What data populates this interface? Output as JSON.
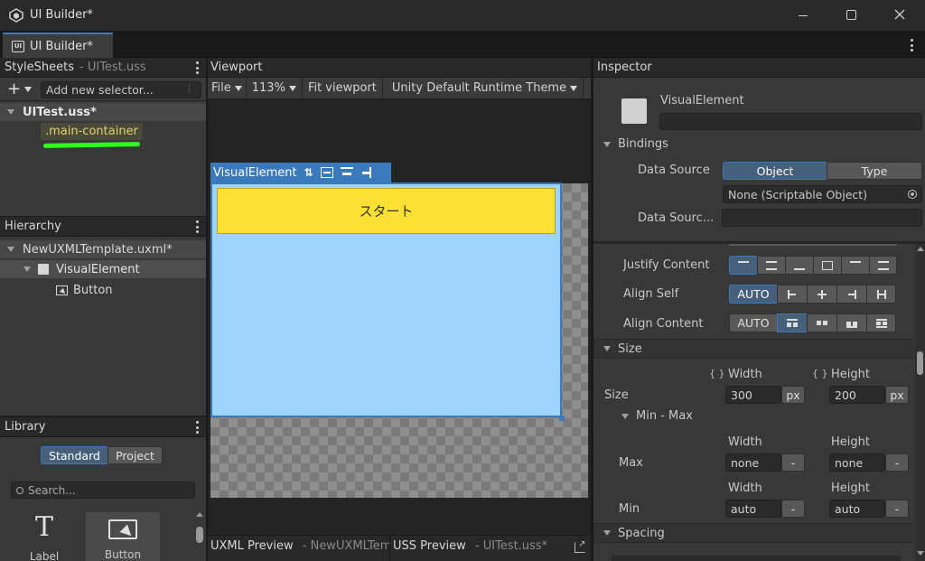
{
  "window": {
    "title": "UI Builder*",
    "tab_label": "UI Builder*"
  },
  "stylesheets": {
    "header": "StyleSheets",
    "header_sub": "- UITest.uss",
    "add_selector_placeholder": "Add new selector...",
    "file": "UITest.uss*",
    "selector": ".main-container"
  },
  "hierarchy": {
    "header": "Hierarchy",
    "root": "NewUXMLTemplate.uxml*",
    "items": [
      {
        "label": "VisualElement"
      },
      {
        "label": "Button"
      }
    ]
  },
  "library": {
    "header": "Library",
    "tabs": [
      "Standard",
      "Project"
    ],
    "search_placeholder": "Search...",
    "items": [
      {
        "label": "Label"
      },
      {
        "label": "Button"
      }
    ]
  },
  "viewport": {
    "header": "Viewport",
    "toolbar": {
      "file": "File",
      "zoom": "113%",
      "fit": "Fit viewport",
      "theme": "Unity Default Runtime Theme"
    },
    "element_label": "VisualElement",
    "button_text": "スタート"
  },
  "bottom_tabs": {
    "uxml": "UXML Preview",
    "uxml_sub": "- NewUXMLTem",
    "uss": "USS Preview",
    "uss_sub": "- UITest.uss*"
  },
  "inspector": {
    "header": "Inspector",
    "element_type": "VisualElement",
    "bindings": {
      "title": "Bindings",
      "data_source_label": "Data Source",
      "options": [
        "Object",
        "Type"
      ],
      "data_source_value": "None (Scriptable Object)",
      "data_source_path_label": "Data Sourc..."
    },
    "flex": {
      "justify_content": "Justify Content",
      "align_self": "Align Self",
      "align_self_auto": "AUTO",
      "align_content": "Align Content",
      "align_content_auto": "AUTO"
    },
    "size": {
      "section": "Size",
      "width_label": "Width",
      "height_label": "Height",
      "row_label": "Size",
      "width": "300",
      "height": "200",
      "unit": "px",
      "minmax_label": "Min - Max",
      "max_label": "Max",
      "max_width": "none",
      "max_height": "none",
      "min_label": "Min",
      "min_width": "auto",
      "min_height": "auto",
      "dash": "-",
      "brace": "{ }"
    },
    "spacing": {
      "section": "Spacing"
    }
  },
  "colors": {
    "accent": "#3a79bb",
    "highlight_text": "#e4d36b",
    "button_yellow": "#fde034",
    "container_blue": "#9dd3fc"
  }
}
